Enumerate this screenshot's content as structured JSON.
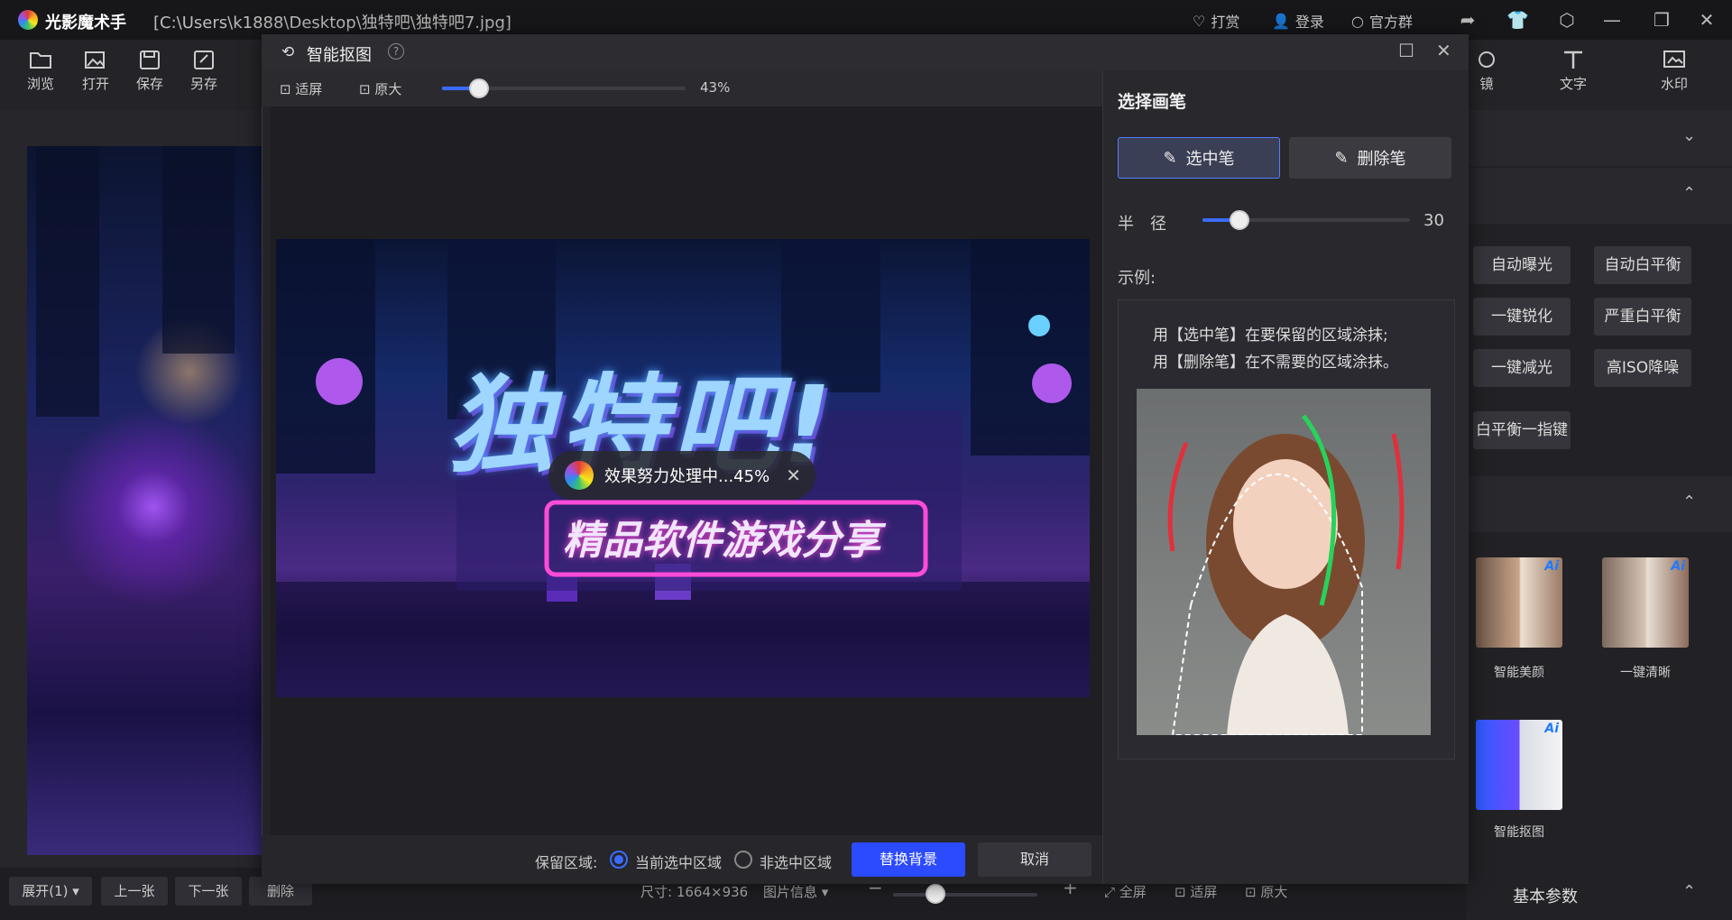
{
  "app": {
    "name": "光影魔术手",
    "path": "[C:\\Users\\k1888\\Desktop\\独特吧\\独特吧7.jpg]"
  },
  "titlebar": {
    "reward": "打赏",
    "login": "登录",
    "group": "官方群"
  },
  "toolbar": {
    "items": [
      "浏览",
      "打开",
      "保存",
      "另存"
    ],
    "right_items": [
      "镜",
      "文字",
      "水印"
    ]
  },
  "right_panel": {
    "quick_buttons": [
      "自动曝光",
      "自动白平衡",
      "一键锐化",
      "严重白平衡",
      "一键减光",
      "高ISO降噪",
      "白平衡一指键"
    ],
    "thumbs": [
      {
        "label": "智能美颜",
        "ai": "Ai"
      },
      {
        "label": "一键清晰",
        "ai": "Ai"
      },
      {
        "label": "智能抠图",
        "ai": "Ai"
      }
    ],
    "basic_params": "基本参数"
  },
  "bottombar": {
    "expand": "展开(1)",
    "prev": "上一张",
    "next": "下一张",
    "delete": "删除",
    "size": "尺寸: 1664×936",
    "info": "图片信息",
    "fullscreen": "全屏",
    "fit": "适屏",
    "original": "原大"
  },
  "modal": {
    "title": "智能抠图",
    "fit": "适屏",
    "original": "原大",
    "zoom": "43%",
    "zoom_value": 0.43,
    "image_title": "独特吧!",
    "image_subtitle": "精品软件游戏分享",
    "progress_text": "效果努力处理中...45%",
    "keep_label": "保留区域:",
    "opt_selected": "当前选中区域",
    "opt_unselected": "非选中区域",
    "replace_bg": "替换背景",
    "cancel": "取消",
    "sidebar": {
      "heading": "选择画笔",
      "select_pen": "选中笔",
      "erase_pen": "删除笔",
      "radius_label": "半　径",
      "radius_value": "30",
      "example_label": "示例:",
      "instr1": "用【选中笔】在要保留的区域涂抹;",
      "instr2": "用【删除笔】在不需要的区域涂抹。"
    }
  }
}
